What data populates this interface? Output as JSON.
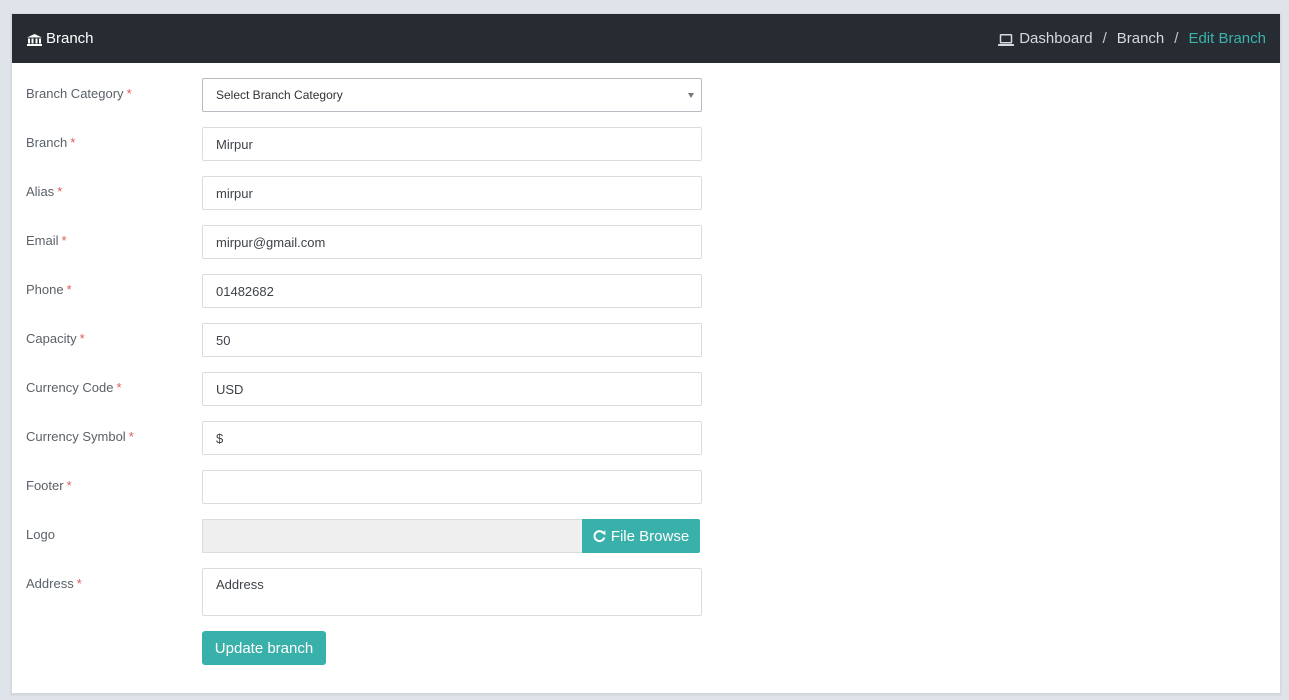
{
  "header": {
    "title": "Branch",
    "breadcrumb": [
      {
        "label": "Dashboard"
      },
      {
        "label": "Branch"
      },
      {
        "label": "Edit Branch"
      }
    ]
  },
  "form": {
    "required_mark": "*",
    "branch_category": {
      "label": "Branch Category",
      "value": "Select Branch Category"
    },
    "branch": {
      "label": "Branch",
      "value": "Mirpur"
    },
    "alias": {
      "label": "Alias",
      "value": "mirpur"
    },
    "email": {
      "label": "Email",
      "value": "mirpur@gmail.com"
    },
    "phone": {
      "label": "Phone",
      "value": "01482682"
    },
    "capacity": {
      "label": "Capacity",
      "value": "50"
    },
    "currency_code": {
      "label": "Currency Code",
      "value": "USD"
    },
    "currency_symbol": {
      "label": "Currency Symbol",
      "value": "$"
    },
    "footer": {
      "label": "Footer",
      "value": ""
    },
    "logo": {
      "label": "Logo",
      "browse_label": "File Browse"
    },
    "address": {
      "label": "Address",
      "placeholder": "Address"
    },
    "submit_label": "Update branch"
  },
  "colors": {
    "header_bg": "#272b32",
    "accent": "#3ab0aa",
    "required": "#e05a5a"
  },
  "icons": {
    "title": "institution-icon",
    "dashboard": "laptop-icon",
    "browse": "refresh-icon"
  }
}
